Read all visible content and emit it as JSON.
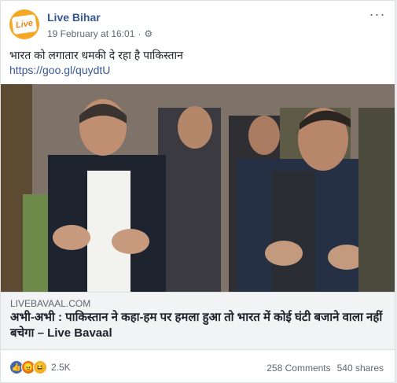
{
  "post": {
    "page_name": "Live Bihar",
    "avatar_text": "Live",
    "timestamp": "19 February at 16:01",
    "separator": "·",
    "text": "भारत को लगातार धमकी दे रहा है पाकिस्तान",
    "link_url": "https://goo.gl/quydtU"
  },
  "link_preview": {
    "domain": "LIVEBAVAAL.COM",
    "title": "अभी-अभी : पाकिस्तान ने कहा-हम पर हमला हुआ तो भारत में कोई घंटी बजाने वाला नहीं बचेगा – Live Bavaal"
  },
  "footer": {
    "reaction_count": "2.5K",
    "comments": "258 Comments",
    "shares": "540 shares"
  },
  "icons": {
    "avatar": "live-bihar-logo",
    "privacy": "gear-icon",
    "more": "more-options-icon",
    "reactions": [
      "like-icon",
      "angry-icon",
      "haha-icon"
    ]
  },
  "colors": {
    "link": "#385898",
    "page_name": "#365899",
    "avatar_bg": "#f5a623"
  }
}
